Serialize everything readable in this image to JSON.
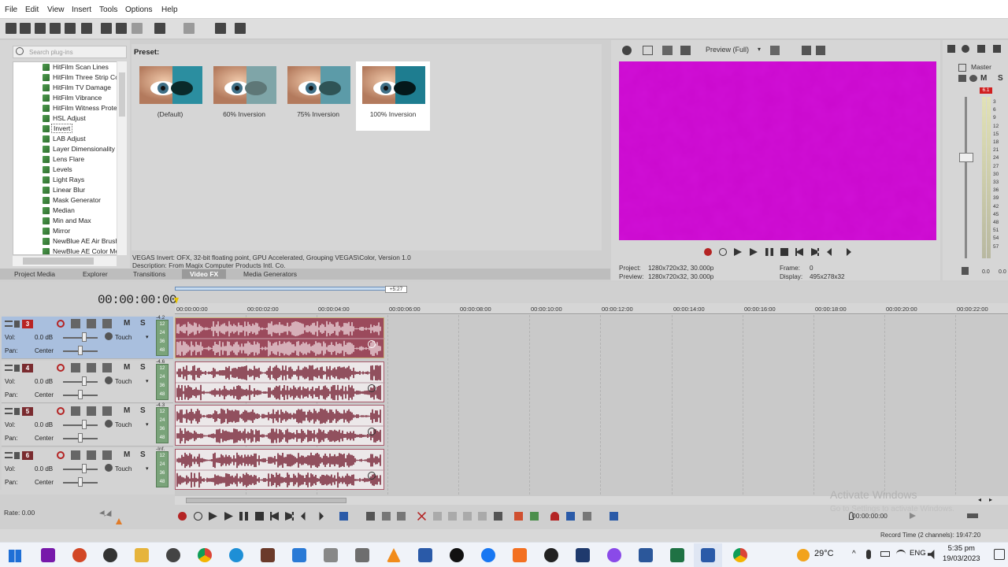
{
  "menu": [
    "File",
    "Edit",
    "View",
    "Insert",
    "Tools",
    "Options",
    "Help"
  ],
  "plugins": {
    "search_placeholder": "Search plug-ins",
    "items": [
      "HitFilm Scan Lines",
      "HitFilm Three Strip Co",
      "HitFilm TV Damage",
      "HitFilm Vibrance",
      "HitFilm Witness Prote",
      "HSL Adjust",
      "Invert",
      "LAB Adjust",
      "Layer Dimensionality",
      "Lens Flare",
      "Levels",
      "Light Rays",
      "Linear Blur",
      "Mask Generator",
      "Median",
      "Min and Max",
      "Mirror",
      "NewBlue AE Air Brush",
      "NewBlue AE Color Me"
    ],
    "selected": "Invert"
  },
  "presets": {
    "label": "Preset:",
    "items": [
      "(Default)",
      "60% Inversion",
      "75% Inversion",
      "100% Inversion"
    ],
    "selected": "100% Inversion"
  },
  "fx_info": {
    "line1": "VEGAS Invert: OFX, 32-bit floating point, GPU Accelerated, Grouping VEGAS\\Color, Version 1.0",
    "line2": "Description: From Magix Computer Products Intl. Co."
  },
  "tabs": [
    "Project Media",
    "Explorer",
    "Transitions",
    "Video FX",
    "Media Generators"
  ],
  "active_tab": "Video FX",
  "preview": {
    "quality": "Preview (Full)",
    "project_label": "Project:",
    "project_value": "1280x720x32, 30.000p",
    "preview_label": "Preview:",
    "preview_value": "1280x720x32, 30.000p",
    "frame_label": "Frame:",
    "frame_value": "0",
    "display_label": "Display:",
    "display_value": "495x278x32",
    "screen_color": "#d010d6"
  },
  "master": {
    "label": "Master",
    "peak": "6.1",
    "scale": [
      "3",
      "6",
      "9",
      "12",
      "15",
      "18",
      "21",
      "24",
      "27",
      "30",
      "33",
      "36",
      "39",
      "42",
      "45",
      "48",
      "51",
      "54",
      "57"
    ],
    "level_l": "0.0",
    "level_r": "0.0"
  },
  "timeline": {
    "timecode": "00:00:00:00",
    "end_marker": "+5:27",
    "ruler": [
      "00:00:00:00",
      "00:00:02:00",
      "00:00:04:00",
      "00:00:06:00",
      "00:00:08:00",
      "00:00:10:00",
      "00:00:12:00",
      "00:00:14:00",
      "00:00:16:00",
      "00:00:18:00",
      "00:00:20:00",
      "00:00:22:00"
    ],
    "tracks": [
      {
        "num": "3",
        "vol_label": "Vol:",
        "vol": "0.0 dB",
        "pan_label": "Pan:",
        "pan": "Center",
        "mode": "Touch",
        "level": "-4.2",
        "selected": true
      },
      {
        "num": "4",
        "vol_label": "Vol:",
        "vol": "0.0 dB",
        "pan_label": "Pan:",
        "pan": "Center",
        "mode": "Touch",
        "level": "-4.6",
        "selected": false
      },
      {
        "num": "5",
        "vol_label": "Vol:",
        "vol": "0.0 dB",
        "pan_label": "Pan:",
        "pan": "Center",
        "mode": "Touch",
        "level": "-4.3",
        "selected": false
      },
      {
        "num": "6",
        "vol_label": "Vol:",
        "vol": "0.0 dB",
        "pan_label": "Pan:",
        "pan": "Center",
        "mode": "Touch",
        "level": "-Inf.",
        "selected": false
      }
    ],
    "mute_label": "M",
    "solo_label": "S",
    "meter_marks": [
      "12",
      "24",
      "36",
      "48"
    ],
    "rate": "Rate: 0.00",
    "status_time": "00:00:00:00",
    "record_time": "Record Time (2 channels): 19:47:20"
  },
  "watermark": {
    "line1": "Activate Windows",
    "line2": "Go to Settings to activate Windows."
  },
  "taskbar": {
    "weather": "29°C",
    "language": "ENG",
    "time": "5:35 pm",
    "date": "19/03/2023"
  }
}
